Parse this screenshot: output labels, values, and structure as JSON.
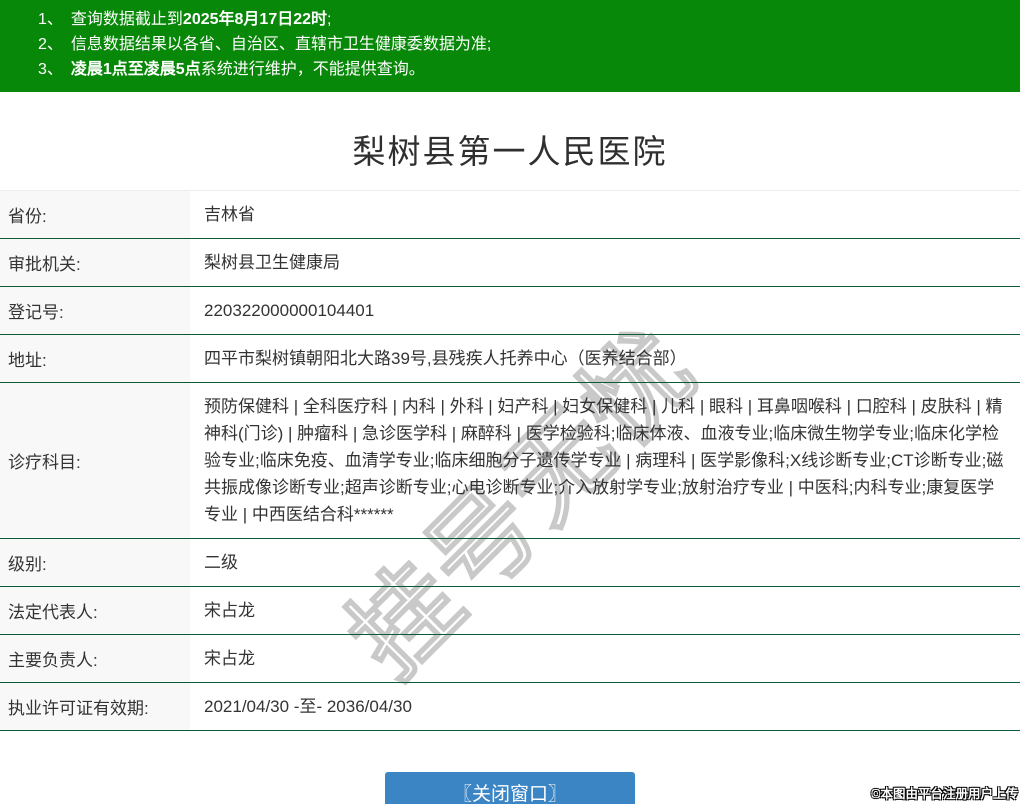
{
  "notices": [
    {
      "num": "1、",
      "segments": [
        {
          "text": "查询数据截止到",
          "bold": false
        },
        {
          "text": "2025年8月17日22时",
          "bold": true
        },
        {
          "text": ";",
          "bold": false
        }
      ]
    },
    {
      "num": "2、",
      "segments": [
        {
          "text": "信息数据结果以各省、自治区、直辖市卫生健康委数据为准;",
          "bold": false
        }
      ]
    },
    {
      "num": "3、",
      "segments": [
        {
          "text": "凌晨1点至凌晨5点",
          "bold": true
        },
        {
          "text": "系统进行维护，不能提供查询。",
          "bold": false
        }
      ]
    }
  ],
  "title": "梨树县第一人民医院",
  "table": {
    "rows": [
      {
        "label": "省份:",
        "value": "吉林省"
      },
      {
        "label": "审批机关:",
        "value": "梨树县卫生健康局"
      },
      {
        "label": "登记号:",
        "value": "220322000000104401"
      },
      {
        "label": "地址:",
        "value": "四平市梨树镇朝阳北大路39号,县残疾人托养中心（医养结合部）"
      },
      {
        "label": "诊疗科目:",
        "value": "预防保健科 | 全科医疗科 | 内科 | 外科 | 妇产科 | 妇女保健科 | 儿科 | 眼科 | 耳鼻咽喉科 | 口腔科 | 皮肤科 | 精神科(门诊) | 肿瘤科 | 急诊医学科 | 麻醉科 | 医学检验科;临床体液、血液专业;临床微生物学专业;临床化学检验专业;临床免疫、血清学专业;临床细胞分子遗传学专业 | 病理科 | 医学影像科;X线诊断专业;CT诊断专业;磁共振成像诊断专业;超声诊断专业;心电诊断专业;介入放射学专业;放射治疗专业 | 中医科;内科专业;康复医学专业 | 中西医结合科******"
      },
      {
        "label": "级别:",
        "value": "二级"
      },
      {
        "label": "法定代表人:",
        "value": "宋占龙"
      },
      {
        "label": "主要负责人:",
        "value": "宋占龙"
      },
      {
        "label": "执业许可证有效期:",
        "value": "2021/04/30 -至- 2036/04/30"
      }
    ]
  },
  "close_button_label": "〖关闭窗口〗",
  "watermark_text": "挂号无忧",
  "credit": "©本图由平台注册用户上传",
  "colors": {
    "header_green": "#088808",
    "divider_green": "#0d5a36",
    "button_blue": "#3c85c5",
    "label_bg": "#f8f8f8",
    "text": "#333333"
  }
}
